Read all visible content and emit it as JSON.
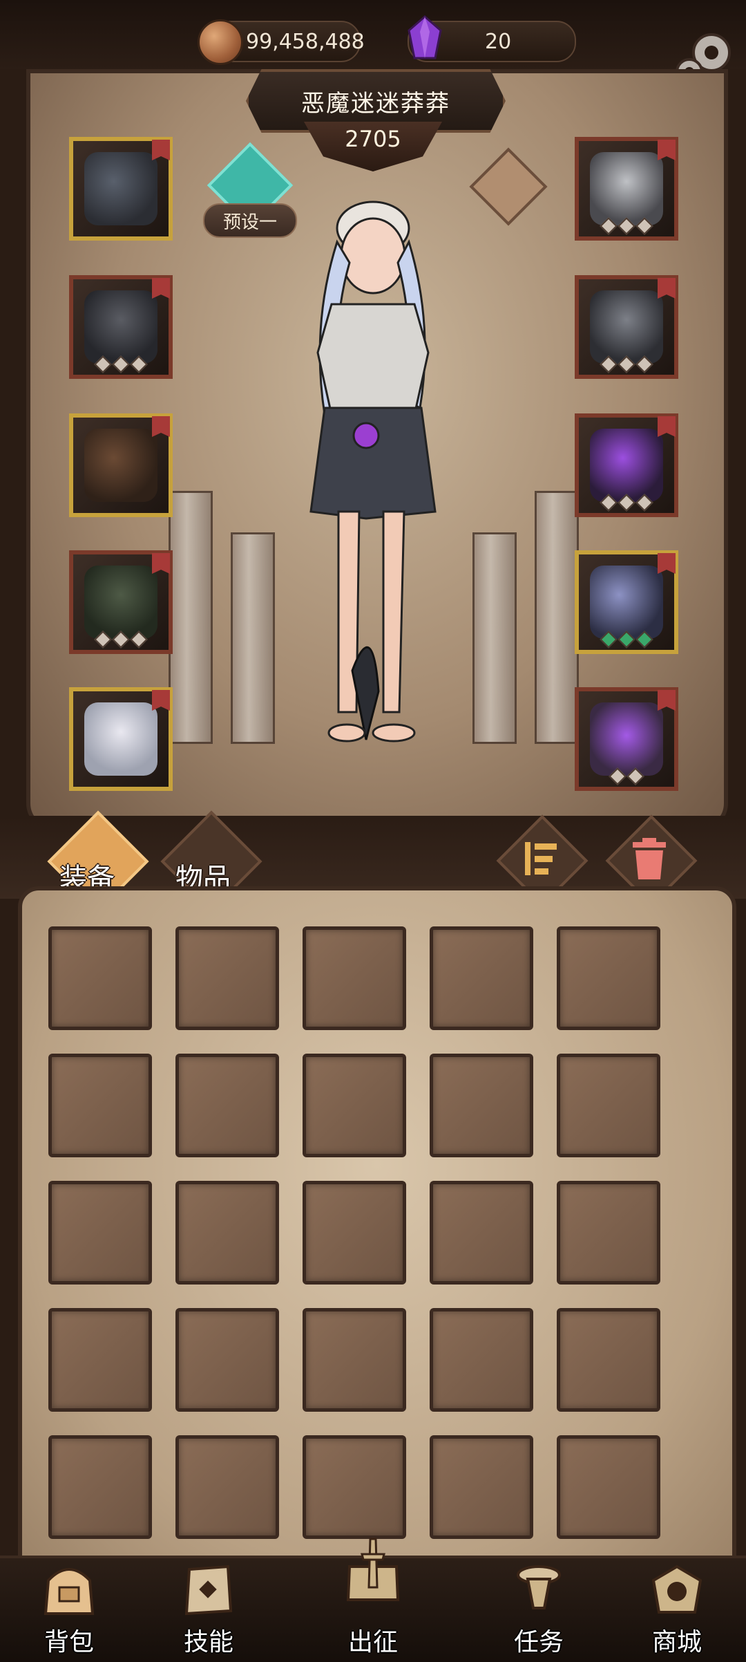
{
  "currencies": {
    "coins": "99,458,488",
    "gems": "20"
  },
  "character": {
    "name": "恶魔迷迷莽莽",
    "power": "2705",
    "preset_label": "预设一"
  },
  "equipment_slots": {
    "left": [
      "weapon",
      "armor",
      "gloves",
      "pants",
      "boots"
    ],
    "right": [
      "helmet",
      "bracer",
      "ring",
      "staff",
      "potion"
    ]
  },
  "tabs": [
    {
      "label": "装备",
      "active": true
    },
    {
      "label": "物品",
      "active": false
    }
  ],
  "tools": [
    "sort-icon",
    "trash-icon"
  ],
  "inventory": {
    "empty_cells": 25
  },
  "nav": [
    {
      "label": "背包",
      "icon": "backpack-icon"
    },
    {
      "label": "技能",
      "icon": "skill-icon"
    },
    {
      "label": "出征",
      "icon": "expedition-icon"
    },
    {
      "label": "任务",
      "icon": "quest-icon"
    },
    {
      "label": "商城",
      "icon": "shop-icon"
    }
  ],
  "colors": {
    "accent_teal": "#3fb7a7",
    "active_tab": "#e1a45b",
    "gem_purple": "#8b3fd1"
  }
}
